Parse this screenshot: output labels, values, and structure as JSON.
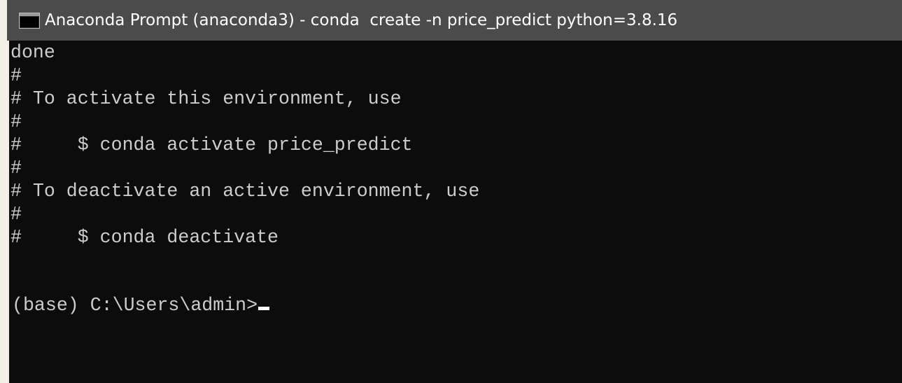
{
  "window": {
    "title": "Anaconda Prompt (anaconda3) - conda  create -n price_predict python=3.8.16",
    "icon": "terminal-icon"
  },
  "console": {
    "lines": [
      "done",
      "#",
      "# To activate this environment, use",
      "#",
      "#     $ conda activate price_predict",
      "#",
      "# To deactivate an active environment, use",
      "#",
      "#     $ conda deactivate"
    ],
    "prompt": "(base) C:\\Users\\admin>"
  },
  "colors": {
    "titlebar_bg": "#4b4b4b",
    "console_bg": "#0c0c0c",
    "console_text": "#cccccc",
    "cursor": "#ffffff"
  }
}
